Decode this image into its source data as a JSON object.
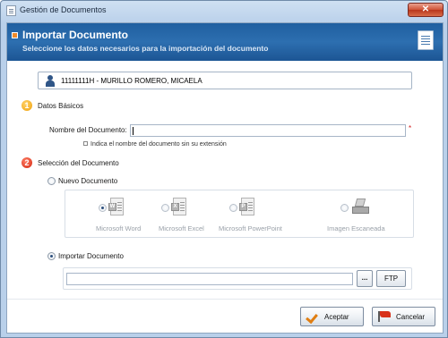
{
  "window": {
    "title": "Gestión de Documentos",
    "close_label": "✕"
  },
  "header": {
    "title": "Importar Documento",
    "subtitle": "Seleccione los datos necesarios para la importación del documento",
    "icon": "document-icon"
  },
  "person": {
    "label": "11111111H - MURILLO ROMERO, MICAELA",
    "icon": "person-icon"
  },
  "step1": {
    "number": "1",
    "label": "Datos Básicos",
    "field_label": "Nombre del Documento:",
    "field_value": "",
    "required_marker": "*",
    "hint": "Indica el nombre del documento sin su extensión"
  },
  "step2": {
    "number": "2",
    "label": "Selección del Documento",
    "new_doc_label": "Nuevo Documento",
    "new_doc_selected": false,
    "formats": [
      {
        "label": "Microsoft Word",
        "icon": "word-icon",
        "badge": "W",
        "selected": true
      },
      {
        "label": "Microsoft Excel",
        "icon": "excel-icon",
        "badge": "X",
        "selected": false
      },
      {
        "label": "Microsoft PowerPoint",
        "icon": "powerpoint-icon",
        "badge": "P",
        "selected": false
      },
      {
        "label": "Imagen Escaneada",
        "icon": "scanner-icon",
        "badge": "",
        "selected": false
      }
    ],
    "import_label": "Importar Documento",
    "import_selected": true,
    "path_value": "",
    "browse_label": "...",
    "ftp_label": "FTP"
  },
  "footer": {
    "accept_label": "Aceptar",
    "cancel_label": "Cancelar"
  },
  "colors": {
    "header_blue": "#2d6fb0",
    "step1_orange": "#f0a10c",
    "step2_red": "#d4260f",
    "required_red": "#d21c1c"
  }
}
